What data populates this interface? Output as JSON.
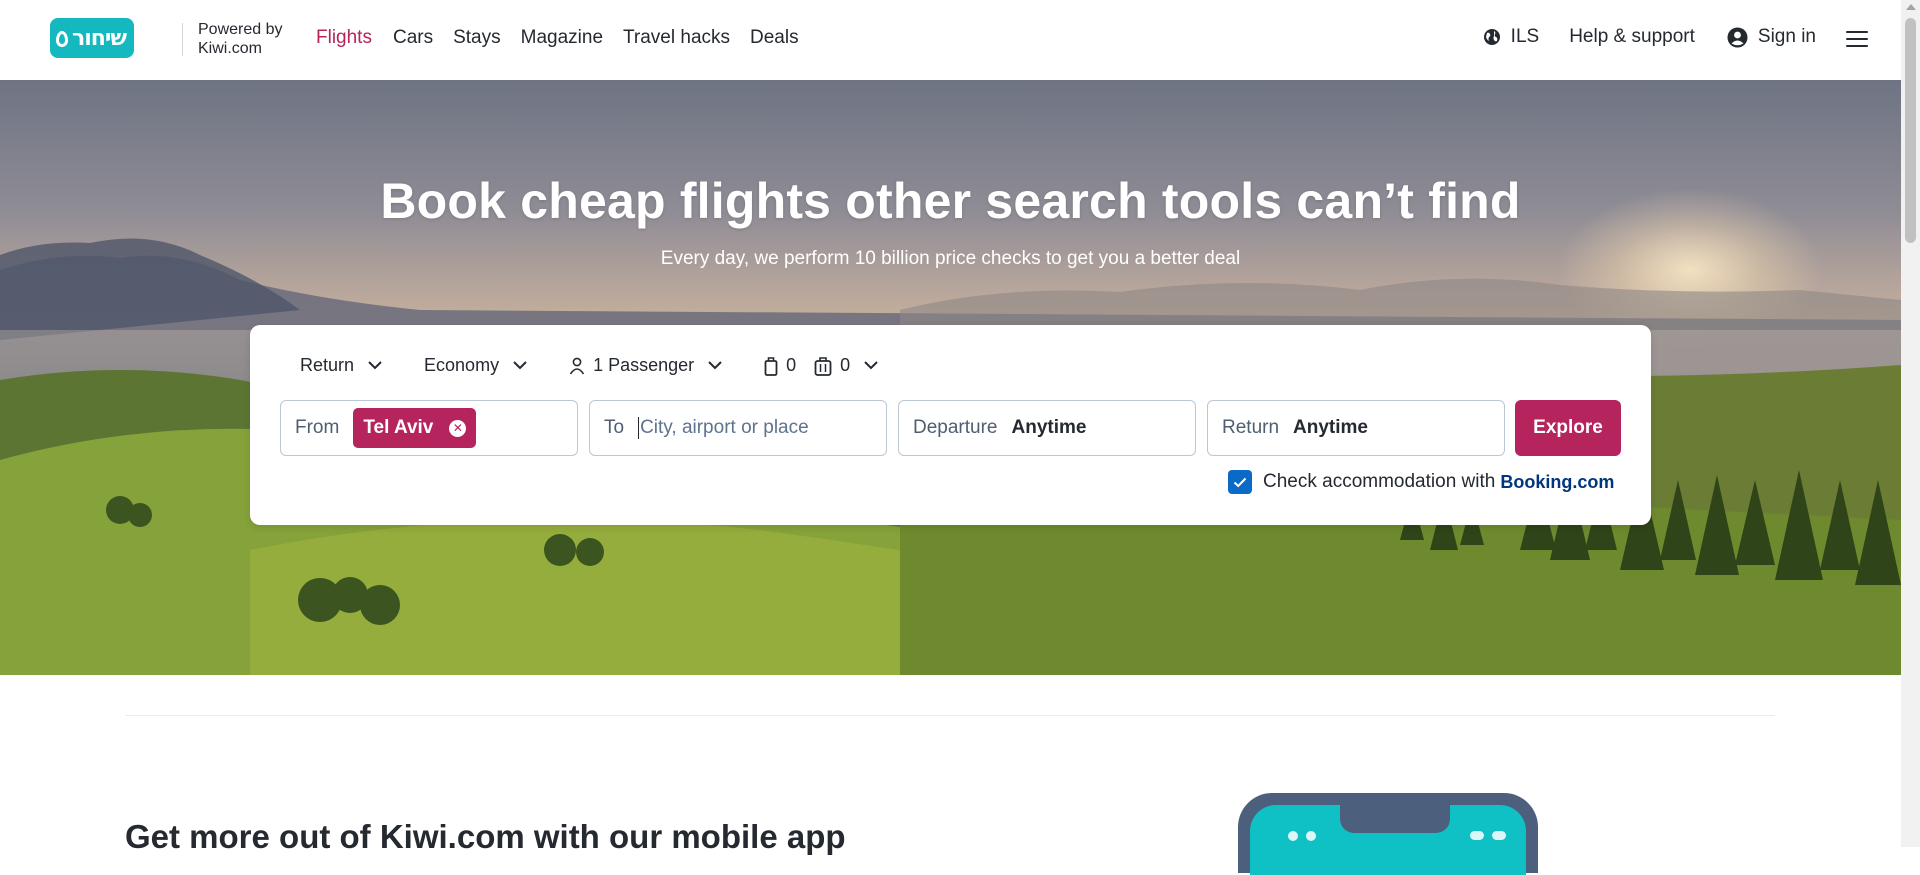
{
  "header": {
    "logo_text": "שיחור",
    "powered_by_line1": "Powered by",
    "powered_by_line2": "Kiwi.com",
    "nav": [
      "Flights",
      "Cars",
      "Stays",
      "Magazine",
      "Travel hacks",
      "Deals"
    ],
    "active_nav": "Flights",
    "currency": "ILS",
    "help": "Help & support",
    "sign_in": "Sign in"
  },
  "hero": {
    "title": "Book cheap flights other search tools can’t find",
    "subtitle": "Every day, we perform 10 billion price checks to get you a better deal"
  },
  "search": {
    "trip_type": "Return",
    "cabin_class": "Economy",
    "passengers": "1 Passenger",
    "cabin_bags": "0",
    "checked_bags": "0",
    "from_label": "From",
    "from_value": "Tel Aviv",
    "to_label": "To",
    "to_placeholder": "City, airport or place",
    "departure_label": "Departure",
    "departure_value": "Anytime",
    "return_label": "Return",
    "return_value": "Anytime",
    "explore": "Explore",
    "accommodation_text": "Check accommodation with",
    "accommodation_brand": "Booking.com",
    "accommodation_checked": true
  },
  "promo": {
    "app_title": "Get more out of Kiwi.com with our mobile app"
  },
  "colors": {
    "brand": "#b5245d",
    "logo": "#14b8be",
    "checkbox": "#0b69c7",
    "booking": "#003580"
  }
}
